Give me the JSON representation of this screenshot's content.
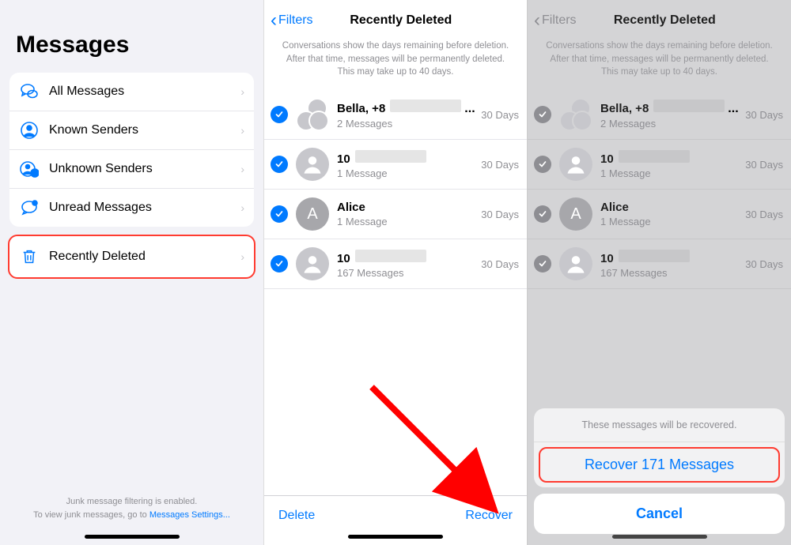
{
  "pane1": {
    "title": "Messages",
    "filters": [
      {
        "label": "All Messages"
      },
      {
        "label": "Known Senders"
      },
      {
        "label": "Unknown Senders"
      },
      {
        "label": "Unread Messages"
      }
    ],
    "recently_deleted_label": "Recently Deleted",
    "footer_line1": "Junk message filtering is enabled.",
    "footer_line2": "To view junk messages, go to ",
    "footer_link": "Messages Settings..."
  },
  "pane2": {
    "back_label": "Filters",
    "title": "Recently Deleted",
    "info": "Conversations show the days remaining before deletion. After that time, messages will be permanently deleted. This may take up to 40 days.",
    "conversations": [
      {
        "name": "Bella, +8",
        "has_blur": true,
        "has_ellipsis": true,
        "sub": "2 Messages",
        "days": "30 Days",
        "avatar": "group"
      },
      {
        "name": "10",
        "has_blur": true,
        "sub": "1 Message",
        "days": "30 Days",
        "avatar": "sil"
      },
      {
        "name": "Alice",
        "sub": "1 Message",
        "days": "30 Days",
        "avatar": "letter",
        "letter": "A"
      },
      {
        "name": "10",
        "has_blur": true,
        "sub": "167 Messages",
        "days": "30 Days",
        "avatar": "sil"
      }
    ],
    "delete_label": "Delete",
    "recover_label": "Recover"
  },
  "pane3": {
    "back_label": "Filters",
    "title": "Recently Deleted",
    "info": "Conversations show the days remaining before deletion. After that time, messages will be permanently deleted. This may take up to 40 days.",
    "conversations": [
      {
        "name": "Bella, +8",
        "has_blur": true,
        "has_ellipsis": true,
        "sub": "2 Messages",
        "days": "30 Days",
        "avatar": "group"
      },
      {
        "name": "10",
        "has_blur": true,
        "sub": "1 Message",
        "days": "30 Days",
        "avatar": "sil"
      },
      {
        "name": "Alice",
        "sub": "1 Message",
        "days": "30 Days",
        "avatar": "letter",
        "letter": "A"
      },
      {
        "name": "10",
        "has_blur": true,
        "sub": "167 Messages",
        "days": "30 Days",
        "avatar": "sil"
      }
    ],
    "sheet_info": "These messages will be recovered.",
    "sheet_action": "Recover 171 Messages",
    "sheet_cancel": "Cancel"
  }
}
